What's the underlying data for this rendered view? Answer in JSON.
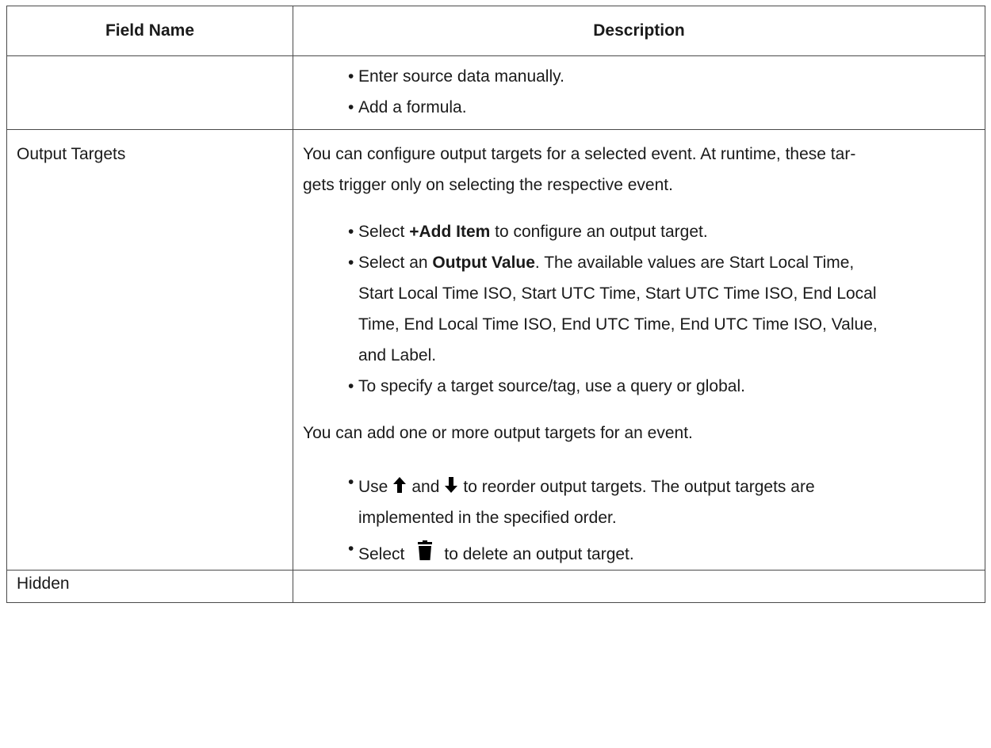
{
  "table": {
    "headers": {
      "field": "Field Name",
      "description": "Description"
    },
    "continued_row": {
      "field": "",
      "bullets": [
        "Enter source data manually.",
        "Add a formula."
      ]
    },
    "output_targets_row": {
      "field": "Output Targets",
      "intro_line1": "You can configure output targets for a selected event. At runtime, these tar-",
      "intro_line2": "gets trigger only on selecting the respective event.",
      "bullet1_pre": "Select ",
      "bullet1_bold": "+Add Item",
      "bullet1_post": " to configure an output target.",
      "bullet2_pre": "Select an ",
      "bullet2_bold": "Output Value",
      "bullet2_line1_post": ". The available values are Start Local Time,",
      "bullet2_line2": "Start Local Time ISO, Start UTC Time, Start UTC Time ISO, End Local",
      "bullet2_line3": "Time, End Local Time ISO, End UTC Time, End UTC Time ISO, Value,",
      "bullet2_line4": "and Label.",
      "bullet3": "To specify a target source/tag, use a query or global.",
      "middle_text": "You can add one or more output targets for an event.",
      "reorder_use": "Use",
      "reorder_and": "and",
      "reorder_line1_post": "to reorder output targets. The output targets are",
      "reorder_line2": "implemented in the specified order.",
      "delete_select": "Select",
      "delete_post": "to delete an output target.",
      "icons": {
        "up": "arrow-up-icon",
        "down": "arrow-down-icon",
        "delete": "trash-icon"
      }
    },
    "hidden_row": {
      "field": "Hidden",
      "description": ""
    }
  },
  "colors": {
    "text": "#1a1a1a",
    "border": "#4a4a4a",
    "background": "#ffffff"
  }
}
